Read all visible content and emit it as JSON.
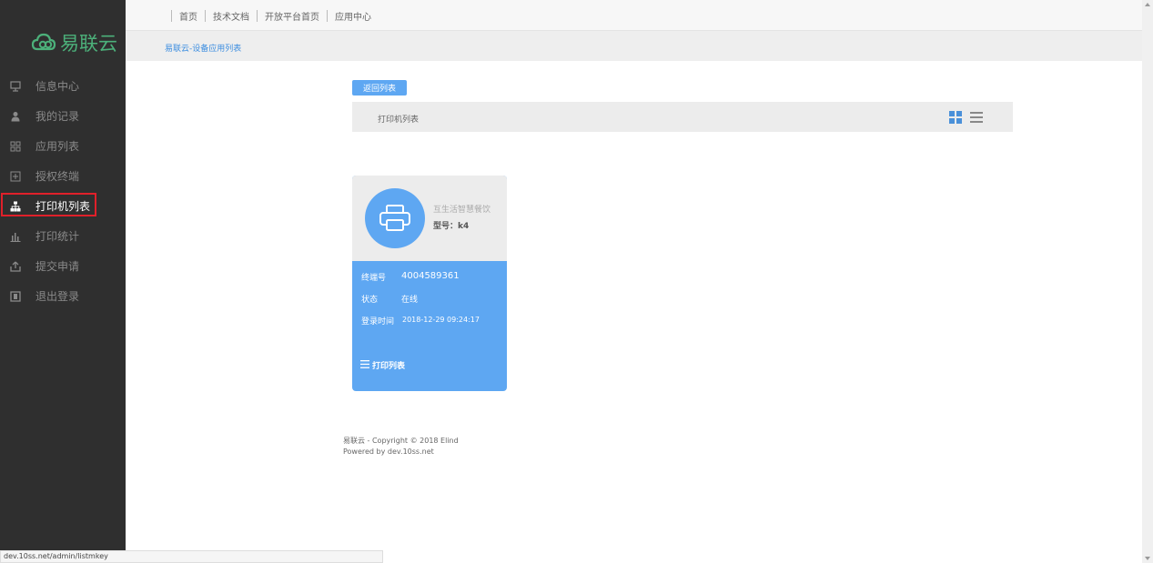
{
  "brand": {
    "name": "易联云",
    "color": "#4cb07a"
  },
  "sidebar": {
    "items": [
      {
        "label": "信息中心",
        "icon": "monitor-icon"
      },
      {
        "label": "我的记录",
        "icon": "user-icon"
      },
      {
        "label": "应用列表",
        "icon": "grid-icon"
      },
      {
        "label": "授权终端",
        "icon": "plus-box-icon"
      },
      {
        "label": "打印机列表",
        "icon": "sitemap-icon",
        "active": true
      },
      {
        "label": "打印统计",
        "icon": "bar-chart-icon"
      },
      {
        "label": "提交申请",
        "icon": "upload-icon"
      },
      {
        "label": "退出登录",
        "icon": "logout-icon"
      }
    ]
  },
  "topnav": {
    "items": [
      "首页",
      "技术文档",
      "开放平台首页",
      "应用中心"
    ]
  },
  "breadcrumb": "易联云-设备应用列表",
  "main": {
    "back_label": "返回列表",
    "panel_title": "打印机列表"
  },
  "card": {
    "name": "互生活智慧餐饮",
    "model": "型号：k4",
    "terminal_label": "终端号",
    "terminal_value": "4004589361",
    "status_label": "状态",
    "status_value": "在线",
    "login_label": "登录时间",
    "login_value": "2018-12-29 09:24:17",
    "link_label": "打印列表"
  },
  "footer": {
    "line1": "易联云 - Copyright © 2018 Elind",
    "line2": "Powered by dev.10ss.net"
  },
  "statusbar": "dev.10ss.net/admin/listmkey",
  "colors": {
    "accent": "#5ea7f2",
    "highlight": "#e0202a",
    "sidebar": "#2f2f2f"
  }
}
